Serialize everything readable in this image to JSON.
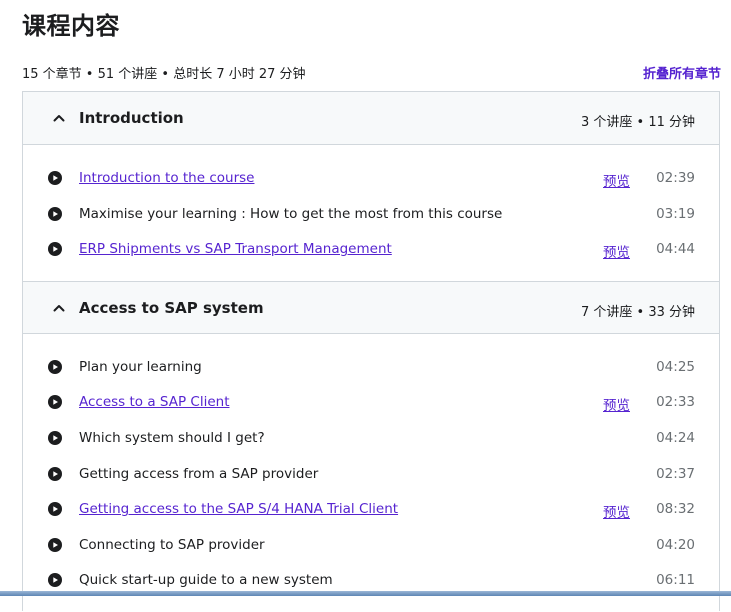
{
  "title": "课程内容",
  "meta": "15 个章节 • 51 个讲座 • 总时长 7 小时 27 分钟",
  "collapse_all": "折叠所有章节",
  "sections": [
    {
      "title": "Introduction",
      "stats": "3 个讲座 • 11 分钟",
      "lectures": [
        {
          "title": "Introduction to the course",
          "preview": "预览",
          "duration": "02:39"
        },
        {
          "title": "Maximise your learning : How to get the most from this course",
          "preview": "",
          "duration": "03:19"
        },
        {
          "title": "ERP Shipments vs SAP Transport Management",
          "preview": "预览",
          "duration": "04:44"
        }
      ]
    },
    {
      "title": "Access to SAP system",
      "stats": "7 个讲座 • 33 分钟",
      "lectures": [
        {
          "title": "Plan your learning",
          "preview": "",
          "duration": "04:25"
        },
        {
          "title": "Access to a SAP Client",
          "preview": "预览",
          "duration": "02:33"
        },
        {
          "title": "Which system should I get?",
          "preview": "",
          "duration": "04:24"
        },
        {
          "title": "Getting access from a SAP provider",
          "preview": "",
          "duration": "02:37"
        },
        {
          "title": "Getting access to the SAP S/4 HANA Trial Client",
          "preview": "预览",
          "duration": "08:32"
        },
        {
          "title": "Connecting to SAP provider",
          "preview": "",
          "duration": "04:20"
        },
        {
          "title": "Quick start-up guide to a new system",
          "preview": "",
          "duration": "06:11"
        }
      ]
    }
  ],
  "icons": {
    "section_toggle": "chevron-up-icon",
    "lecture": "play-circle-icon"
  },
  "colors": {
    "accent": "#5624d0",
    "text": "#1c1d1f",
    "muted": "#6a6f73",
    "header_bg": "#f7f9fa",
    "border": "#d1d7dc"
  }
}
